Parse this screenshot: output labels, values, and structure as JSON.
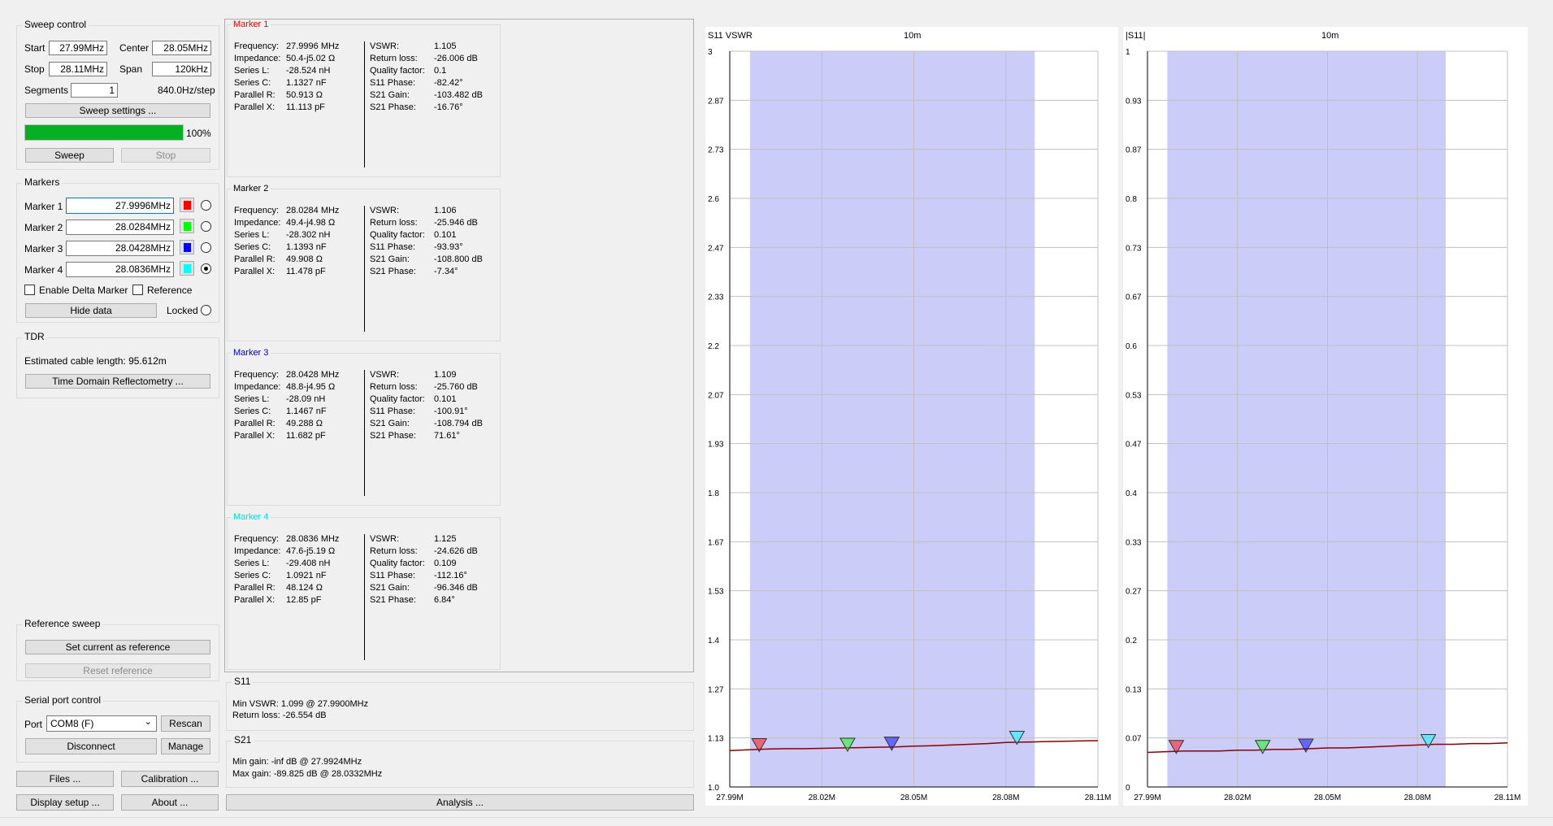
{
  "sweep": {
    "title": "Sweep control",
    "start_label": "Start",
    "start_value": "27.99MHz",
    "center_label": "Center",
    "center_value": "28.05MHz",
    "stop_label": "Stop",
    "stop_value": "28.11MHz",
    "span_label": "Span",
    "span_value": "120kHz",
    "segments_label": "Segments",
    "segments_value": "1",
    "step_text": "840.0Hz/step",
    "settings_button": "Sweep settings ...",
    "progress_percent": 100,
    "progress_text": "100%",
    "sweep_button": "Sweep",
    "stop_button": "Stop"
  },
  "markers_box": {
    "title": "Markers",
    "items": [
      {
        "label": "Marker 1",
        "value": "27.9996MHz",
        "color": "#ff0000",
        "selected": false
      },
      {
        "label": "Marker 2",
        "value": "28.0284MHz",
        "color": "#00ff00",
        "selected": false
      },
      {
        "label": "Marker 3",
        "value": "28.0428MHz",
        "color": "#0000ff",
        "selected": false
      },
      {
        "label": "Marker 4",
        "value": "28.0836MHz",
        "color": "#00ffff",
        "selected": true
      }
    ],
    "delta_label": "Enable Delta Marker",
    "reference_label": "Reference",
    "hide_button": "Hide data",
    "locked_label": "Locked"
  },
  "tdr": {
    "title": "TDR",
    "cable_text": "Estimated cable length:  95.612m",
    "button": "Time Domain Reflectometry ..."
  },
  "reference_sweep": {
    "title": "Reference sweep",
    "set_button": "Set current as reference",
    "reset_button": "Reset reference"
  },
  "serial": {
    "title": "Serial port control",
    "port_label": "Port",
    "port_value": "COM8 (F)",
    "rescan_button": "Rescan",
    "disconnect_button": "Disconnect",
    "manage_button": "Manage"
  },
  "bottom_buttons": {
    "files": "Files ...",
    "calibration": "Calibration ...",
    "display": "Display setup ...",
    "about": "About ...",
    "analysis": "Analysis ..."
  },
  "marker_panels": [
    {
      "title": "Marker 1",
      "title_color": "#ff0000",
      "left": [
        [
          "Frequency:",
          "27.9996 MHz"
        ],
        [
          "Impedance:",
          "50.4-j5.02 Ω"
        ],
        [
          "Series L:",
          "-28.524 nH"
        ],
        [
          "Series C:",
          "1.1327 nF"
        ],
        [
          "Parallel R:",
          "50.913 Ω"
        ],
        [
          "Parallel X:",
          "11.113 pF"
        ]
      ],
      "right": [
        [
          "VSWR:",
          "1.105"
        ],
        [
          "Return loss:",
          "-26.006 dB"
        ],
        [
          "Quality factor:",
          "0.1"
        ],
        [
          "S11 Phase:",
          "-82.42°"
        ],
        [
          "S21 Gain:",
          "-103.482 dB"
        ],
        [
          "S21 Phase:",
          "-16.76°"
        ]
      ]
    },
    {
      "title": "Marker 2",
      "title_color": "#000000",
      "left": [
        [
          "Frequency:",
          "28.0284 MHz"
        ],
        [
          "Impedance:",
          "49.4-j4.98 Ω"
        ],
        [
          "Series L:",
          "-28.302 nH"
        ],
        [
          "Series C:",
          "1.1393 nF"
        ],
        [
          "Parallel R:",
          "49.908 Ω"
        ],
        [
          "Parallel X:",
          "11.478 pF"
        ]
      ],
      "right": [
        [
          "VSWR:",
          "1.106"
        ],
        [
          "Return loss:",
          "-25.946 dB"
        ],
        [
          "Quality factor:",
          "0.101"
        ],
        [
          "S11 Phase:",
          "-93.93°"
        ],
        [
          "S21 Gain:",
          "-108.800 dB"
        ],
        [
          "S21 Phase:",
          "-7.34°"
        ]
      ]
    },
    {
      "title": "Marker 3",
      "title_color": "#0000cc",
      "left": [
        [
          "Frequency:",
          "28.0428 MHz"
        ],
        [
          "Impedance:",
          "48.8-j4.95 Ω"
        ],
        [
          "Series L:",
          "-28.09 nH"
        ],
        [
          "Series C:",
          "1.1467 nF"
        ],
        [
          "Parallel R:",
          "49.288 Ω"
        ],
        [
          "Parallel X:",
          "11.682 pF"
        ]
      ],
      "right": [
        [
          "VSWR:",
          "1.109"
        ],
        [
          "Return loss:",
          "-25.760 dB"
        ],
        [
          "Quality factor:",
          "0.101"
        ],
        [
          "S11 Phase:",
          "-100.91°"
        ],
        [
          "S21 Gain:",
          "-108.794 dB"
        ],
        [
          "S21 Phase:",
          "71.61°"
        ]
      ]
    },
    {
      "title": "Marker 4",
      "title_color": "#00e0e0",
      "left": [
        [
          "Frequency:",
          "28.0836 MHz"
        ],
        [
          "Impedance:",
          "47.6-j5.19 Ω"
        ],
        [
          "Series L:",
          "-29.408 nH"
        ],
        [
          "Series C:",
          "1.0921 nF"
        ],
        [
          "Parallel R:",
          "48.124 Ω"
        ],
        [
          "Parallel X:",
          "12.85 pF"
        ]
      ],
      "right": [
        [
          "VSWR:",
          "1.125"
        ],
        [
          "Return loss:",
          "-24.626 dB"
        ],
        [
          "Quality factor:",
          "0.109"
        ],
        [
          "S11 Phase:",
          "-112.16°"
        ],
        [
          "S21 Gain:",
          "-96.346 dB"
        ],
        [
          "S21 Phase:",
          "6.84°"
        ]
      ]
    }
  ],
  "s11_summary": {
    "title": "S11",
    "min_vswr": "Min VSWR:  1.099 @ 27.9900MHz",
    "return_loss": "Return loss:  -26.554 dB"
  },
  "s21_summary": {
    "title": "S21",
    "min_gain": "Min gain:  -inf dB @ 27.9924MHz",
    "max_gain": "Max gain:  -89.825 dB @ 28.0332MHz"
  },
  "chart_data": [
    {
      "type": "line",
      "title": "S11 VSWR",
      "subtitle": "10m",
      "band_color": "#ccccf8",
      "band": [
        27.9966,
        28.0894
      ],
      "xlim": [
        27.99,
        28.11
      ],
      "ylim": [
        1.0,
        3.0
      ],
      "x_ticks": [
        27.99,
        28.02,
        28.05,
        28.08,
        28.11
      ],
      "x_tick_labels": [
        "27.99M",
        "28.02M",
        "28.05M",
        "28.08M",
        "28.11M"
      ],
      "y_tick_labels": [
        "3",
        "2.87",
        "2.73",
        "2.6",
        "2.47",
        "2.33",
        "2.2",
        "2.07",
        "1.93",
        "1.8",
        "1.67",
        "1.53",
        "1.4",
        "1.27",
        "1.13",
        "1.0"
      ],
      "trace_color": "#8b0000",
      "x": [
        27.99,
        27.996,
        28.002,
        28.008,
        28.014,
        28.02,
        28.026,
        28.032,
        28.038,
        28.044,
        28.05,
        28.056,
        28.062,
        28.068,
        28.074,
        28.08,
        28.086,
        28.092,
        28.098,
        28.104,
        28.11
      ],
      "y": [
        1.099,
        1.101,
        1.103,
        1.104,
        1.104,
        1.105,
        1.106,
        1.107,
        1.108,
        1.109,
        1.111,
        1.112,
        1.114,
        1.116,
        1.118,
        1.121,
        1.122,
        1.123,
        1.124,
        1.125,
        1.126
      ],
      "markers": [
        {
          "x": 27.9996,
          "y": 1.105,
          "color": "#ff0000"
        },
        {
          "x": 28.0284,
          "y": 1.106,
          "color": "#00ff00"
        },
        {
          "x": 28.0428,
          "y": 1.109,
          "color": "#0000ff"
        },
        {
          "x": 28.0836,
          "y": 1.125,
          "color": "#00ffff"
        }
      ]
    },
    {
      "type": "line",
      "title": "|S11|",
      "subtitle": "10m",
      "band_color": "#ccccf8",
      "band": [
        27.9966,
        28.0894
      ],
      "xlim": [
        27.99,
        28.11
      ],
      "ylim": [
        0.0,
        1.0
      ],
      "x_ticks": [
        27.99,
        28.02,
        28.05,
        28.08,
        28.11
      ],
      "x_tick_labels": [
        "27.99M",
        "28.02M",
        "28.05M",
        "28.08M",
        "28.11M"
      ],
      "y_tick_labels": [
        "1",
        "0.93",
        "0.87",
        "0.8",
        "0.73",
        "0.67",
        "0.6",
        "0.53",
        "0.47",
        "0.4",
        "0.33",
        "0.27",
        "0.2",
        "0.13",
        "0.07",
        "0"
      ],
      "trace_color": "#8b0000",
      "x": [
        27.99,
        27.996,
        28.002,
        28.008,
        28.014,
        28.02,
        28.026,
        28.032,
        28.038,
        28.044,
        28.05,
        28.056,
        28.062,
        28.068,
        28.074,
        28.08,
        28.086,
        28.092,
        28.098,
        28.104,
        28.11
      ],
      "y": [
        0.047,
        0.048,
        0.049,
        0.049,
        0.049,
        0.05,
        0.05,
        0.051,
        0.051,
        0.052,
        0.053,
        0.053,
        0.054,
        0.055,
        0.056,
        0.057,
        0.058,
        0.058,
        0.059,
        0.059,
        0.06
      ],
      "markers": [
        {
          "x": 27.9996,
          "y": 0.05,
          "color": "#ff0000"
        },
        {
          "x": 28.0284,
          "y": 0.05,
          "color": "#00ff00"
        },
        {
          "x": 28.0428,
          "y": 0.052,
          "color": "#0000ff"
        },
        {
          "x": 28.0836,
          "y": 0.058,
          "color": "#00ffff"
        }
      ]
    }
  ]
}
